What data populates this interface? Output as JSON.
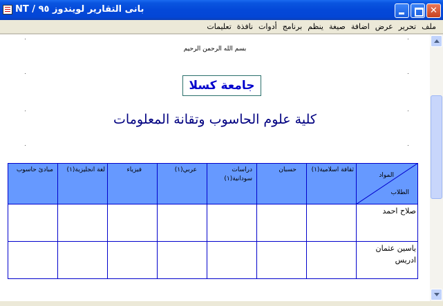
{
  "window": {
    "title": "NT / بانى التقارير لويندوز ٩٥"
  },
  "menu": [
    "ملف",
    "تحرير",
    "عرض",
    "اضافة",
    "صيغة",
    "ينظم",
    "برنامج",
    "أدوات",
    "نافذة",
    "تعليمات"
  ],
  "document": {
    "bismillah": "بسم الله الرحمن الرحيم",
    "university": "جامعة كسلا",
    "faculty": "كلية علوم الحاسوب وتقانة المعلومات",
    "table": {
      "corner_top": "المواد",
      "corner_bottom": "الطلاب",
      "subjects": [
        "ثقافة اسلامية(١)",
        "حسبان",
        "دراسات سودانية(١)",
        "عربي(١)",
        "فيزياء",
        "لغة انجليزية(١)",
        "مبادئ حاسوب"
      ],
      "students": [
        "صلاح احمد",
        "ياسين عثمان ادريس"
      ]
    }
  }
}
